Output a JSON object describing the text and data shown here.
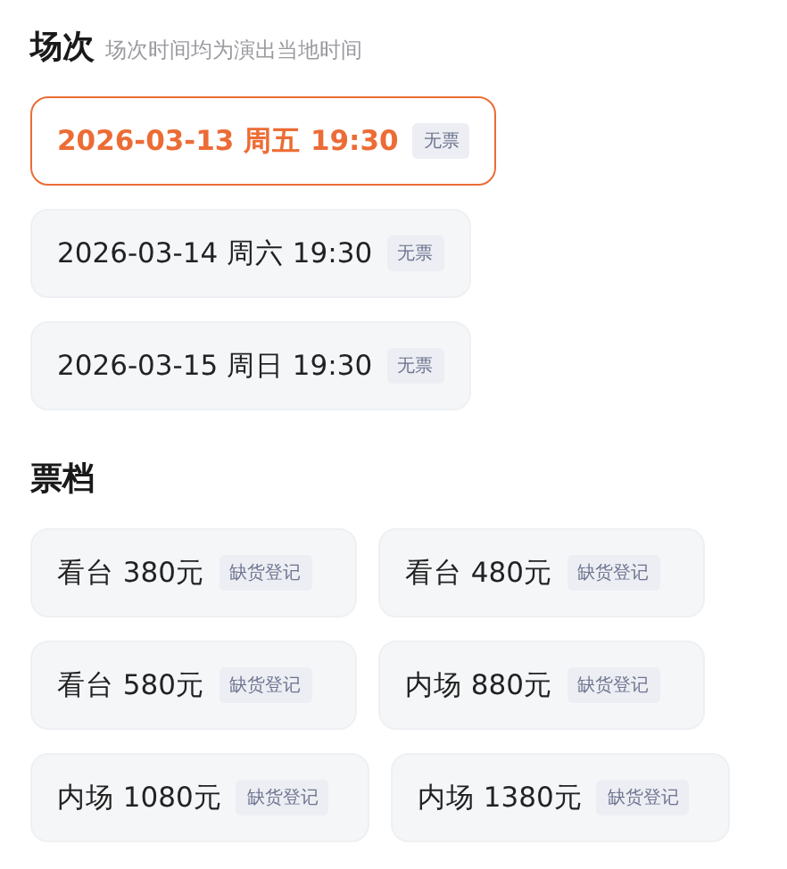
{
  "sessions_section": {
    "title": "场次",
    "note": "场次时间均为演出当地时间"
  },
  "sessions": [
    {
      "label": "2026-03-13 周五 19:30",
      "badge": "无票",
      "selected": true
    },
    {
      "label": "2026-03-14 周六 19:30",
      "badge": "无票",
      "selected": false
    },
    {
      "label": "2026-03-15 周日 19:30",
      "badge": "无票",
      "selected": false
    }
  ],
  "tiers_section": {
    "title": "票档"
  },
  "tiers": [
    {
      "label": "看台 380元",
      "badge": "缺货登记",
      "selected": false
    },
    {
      "label": "看台 480元",
      "badge": "缺货登记",
      "selected": false
    },
    {
      "label": "看台 580元",
      "badge": "缺货登记",
      "selected": false
    },
    {
      "label": "内场 880元",
      "badge": "缺货登记",
      "selected": false
    },
    {
      "label": "内场 1080元",
      "badge": "缺货登记",
      "selected": false
    },
    {
      "label": "内场 1380元",
      "badge": "缺货登记",
      "selected": false
    }
  ]
}
